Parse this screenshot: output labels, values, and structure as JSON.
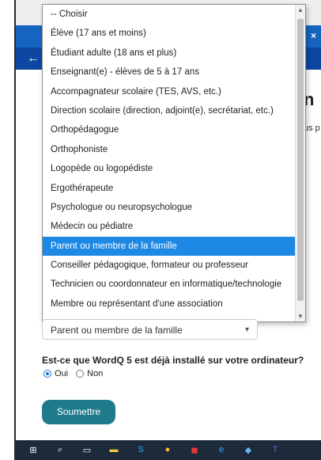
{
  "page": {
    "title_fragment": "n",
    "text_fragment": "us p"
  },
  "tab": {
    "close_label": "×"
  },
  "dropdown": {
    "items": [
      "-- Choisir",
      "Élève (17 ans et moins)",
      "Étudiant adulte (18 ans et plus)",
      "Enseignant(e) - élèves de 5 à 17 ans",
      "Accompagnateur scolaire (TES, AVS, etc.)",
      "Direction scolaire (direction, adjoint(e), secrétariat, etc.)",
      "Orthopédagogue",
      "Orthophoniste",
      "Logopède ou logopédiste",
      "Ergothérapeute",
      "Psychologue ou neuropsychologue",
      "Médecin ou pédiatre",
      "Parent ou membre de la famille",
      "Conseiller pédagogique, formateur ou professeur",
      "Technicien ou coordonnateur en informatique/technologie",
      "Membre ou représentant d'une association"
    ],
    "selected_index": 12
  },
  "form": {
    "selected_value": "Parent ou membre de la famille",
    "question": "Est-ce que WordQ 5 est déjà installé sur votre ordinateur?",
    "option_yes": "Oui",
    "option_no": "Non",
    "submit_label": "Soumettre"
  },
  "colors": {
    "selected_bg": "#1e88e5",
    "tab_bar": "#1565c0",
    "submit_bg": "#1f7a8c",
    "taskbar_bg": "#1d2a3a"
  },
  "taskbar": {
    "icons": [
      "windows-start-icon",
      "search-icon",
      "task-view-icon",
      "file-explorer-icon",
      "skype-icon",
      "chrome-icon",
      "app-icon",
      "edge-icon",
      "store-icon",
      "teams-icon"
    ]
  }
}
